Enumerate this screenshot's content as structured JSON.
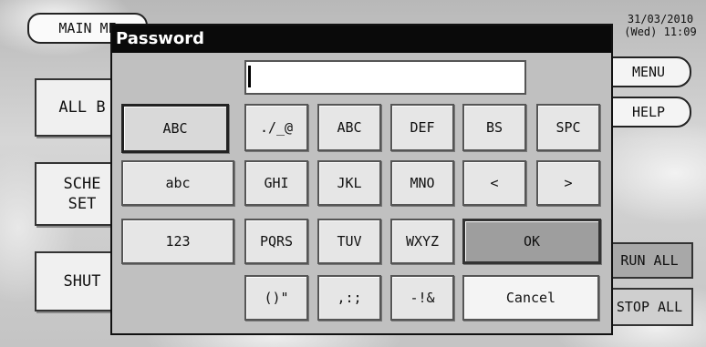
{
  "background": {
    "main_menu": "MAIN ME",
    "datetime": {
      "date": "31/03/2010",
      "day_time": "(Wed) 11:09"
    },
    "left_buttons": [
      "ALL B",
      "SCHE\nSET",
      "SHUT"
    ],
    "right_buttons": {
      "menu": "MENU",
      "help": "HELP",
      "run_all": "RUN ALL",
      "stop_all": "STOP ALL"
    }
  },
  "dialog": {
    "title": "Password",
    "password_value": "",
    "mode_keys": {
      "upper": "ABC",
      "lower": "abc",
      "num": "123"
    },
    "keys": {
      "k1": "./_@",
      "k2": "ABC",
      "k3": "DEF",
      "bs": "BS",
      "spc": "SPC",
      "k4": "GHI",
      "k5": "JKL",
      "k6": "MNO",
      "left": "<",
      "right": ">",
      "k7": "PQRS",
      "k8": "TUV",
      "k9": "WXYZ",
      "ok": "OK",
      "k10": "()\"",
      "k11": ",:;",
      "k12": "-!&",
      "cancel": "Cancel"
    }
  }
}
